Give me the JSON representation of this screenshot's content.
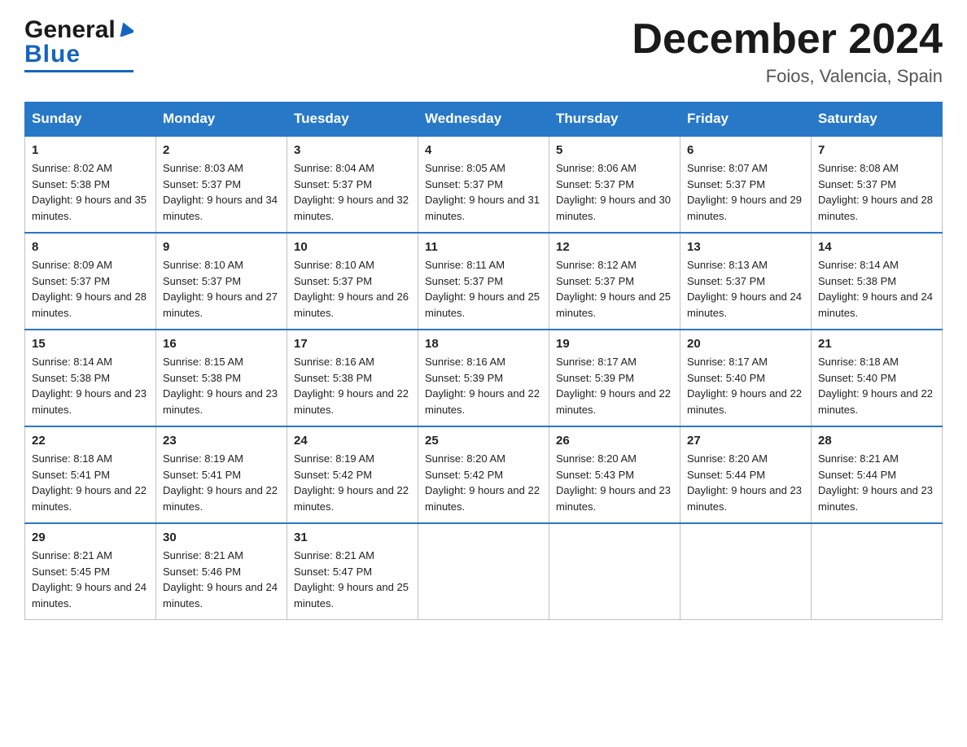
{
  "header": {
    "logo_general": "General",
    "logo_blue": "Blue",
    "month_title": "December 2024",
    "location": "Foios, Valencia, Spain"
  },
  "days_of_week": [
    "Sunday",
    "Monday",
    "Tuesday",
    "Wednesday",
    "Thursday",
    "Friday",
    "Saturday"
  ],
  "weeks": [
    [
      {
        "day": "1",
        "sunrise": "8:02 AM",
        "sunset": "5:38 PM",
        "daylight": "9 hours and 35 minutes."
      },
      {
        "day": "2",
        "sunrise": "8:03 AM",
        "sunset": "5:37 PM",
        "daylight": "9 hours and 34 minutes."
      },
      {
        "day": "3",
        "sunrise": "8:04 AM",
        "sunset": "5:37 PM",
        "daylight": "9 hours and 32 minutes."
      },
      {
        "day": "4",
        "sunrise": "8:05 AM",
        "sunset": "5:37 PM",
        "daylight": "9 hours and 31 minutes."
      },
      {
        "day": "5",
        "sunrise": "8:06 AM",
        "sunset": "5:37 PM",
        "daylight": "9 hours and 30 minutes."
      },
      {
        "day": "6",
        "sunrise": "8:07 AM",
        "sunset": "5:37 PM",
        "daylight": "9 hours and 29 minutes."
      },
      {
        "day": "7",
        "sunrise": "8:08 AM",
        "sunset": "5:37 PM",
        "daylight": "9 hours and 28 minutes."
      }
    ],
    [
      {
        "day": "8",
        "sunrise": "8:09 AM",
        "sunset": "5:37 PM",
        "daylight": "9 hours and 28 minutes."
      },
      {
        "day": "9",
        "sunrise": "8:10 AM",
        "sunset": "5:37 PM",
        "daylight": "9 hours and 27 minutes."
      },
      {
        "day": "10",
        "sunrise": "8:10 AM",
        "sunset": "5:37 PM",
        "daylight": "9 hours and 26 minutes."
      },
      {
        "day": "11",
        "sunrise": "8:11 AM",
        "sunset": "5:37 PM",
        "daylight": "9 hours and 25 minutes."
      },
      {
        "day": "12",
        "sunrise": "8:12 AM",
        "sunset": "5:37 PM",
        "daylight": "9 hours and 25 minutes."
      },
      {
        "day": "13",
        "sunrise": "8:13 AM",
        "sunset": "5:37 PM",
        "daylight": "9 hours and 24 minutes."
      },
      {
        "day": "14",
        "sunrise": "8:14 AM",
        "sunset": "5:38 PM",
        "daylight": "9 hours and 24 minutes."
      }
    ],
    [
      {
        "day": "15",
        "sunrise": "8:14 AM",
        "sunset": "5:38 PM",
        "daylight": "9 hours and 23 minutes."
      },
      {
        "day": "16",
        "sunrise": "8:15 AM",
        "sunset": "5:38 PM",
        "daylight": "9 hours and 23 minutes."
      },
      {
        "day": "17",
        "sunrise": "8:16 AM",
        "sunset": "5:38 PM",
        "daylight": "9 hours and 22 minutes."
      },
      {
        "day": "18",
        "sunrise": "8:16 AM",
        "sunset": "5:39 PM",
        "daylight": "9 hours and 22 minutes."
      },
      {
        "day": "19",
        "sunrise": "8:17 AM",
        "sunset": "5:39 PM",
        "daylight": "9 hours and 22 minutes."
      },
      {
        "day": "20",
        "sunrise": "8:17 AM",
        "sunset": "5:40 PM",
        "daylight": "9 hours and 22 minutes."
      },
      {
        "day": "21",
        "sunrise": "8:18 AM",
        "sunset": "5:40 PM",
        "daylight": "9 hours and 22 minutes."
      }
    ],
    [
      {
        "day": "22",
        "sunrise": "8:18 AM",
        "sunset": "5:41 PM",
        "daylight": "9 hours and 22 minutes."
      },
      {
        "day": "23",
        "sunrise": "8:19 AM",
        "sunset": "5:41 PM",
        "daylight": "9 hours and 22 minutes."
      },
      {
        "day": "24",
        "sunrise": "8:19 AM",
        "sunset": "5:42 PM",
        "daylight": "9 hours and 22 minutes."
      },
      {
        "day": "25",
        "sunrise": "8:20 AM",
        "sunset": "5:42 PM",
        "daylight": "9 hours and 22 minutes."
      },
      {
        "day": "26",
        "sunrise": "8:20 AM",
        "sunset": "5:43 PM",
        "daylight": "9 hours and 23 minutes."
      },
      {
        "day": "27",
        "sunrise": "8:20 AM",
        "sunset": "5:44 PM",
        "daylight": "9 hours and 23 minutes."
      },
      {
        "day": "28",
        "sunrise": "8:21 AM",
        "sunset": "5:44 PM",
        "daylight": "9 hours and 23 minutes."
      }
    ],
    [
      {
        "day": "29",
        "sunrise": "8:21 AM",
        "sunset": "5:45 PM",
        "daylight": "9 hours and 24 minutes."
      },
      {
        "day": "30",
        "sunrise": "8:21 AM",
        "sunset": "5:46 PM",
        "daylight": "9 hours and 24 minutes."
      },
      {
        "day": "31",
        "sunrise": "8:21 AM",
        "sunset": "5:47 PM",
        "daylight": "9 hours and 25 minutes."
      },
      null,
      null,
      null,
      null
    ]
  ]
}
